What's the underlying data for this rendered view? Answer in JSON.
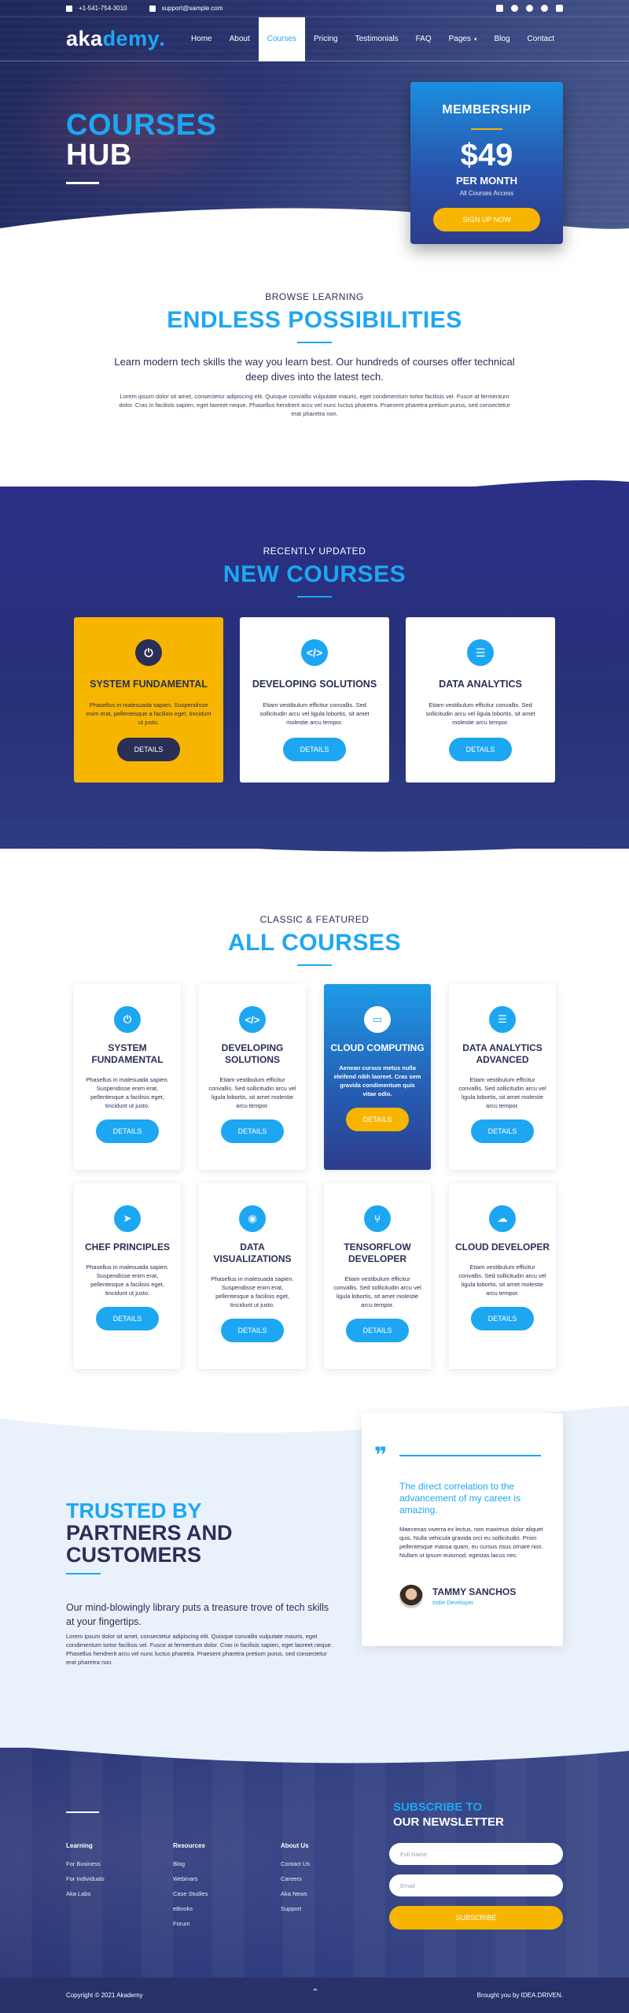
{
  "topbar": {
    "phone": "+1-541-754-3010",
    "email": "support@sample.com",
    "social": [
      "linkedin-icon",
      "facebook-icon",
      "twitter-icon",
      "skype-icon",
      "youtube-icon"
    ]
  },
  "nav": {
    "logo_main": "aka",
    "logo_accent": "demy",
    "items": [
      {
        "label": "Home"
      },
      {
        "label": "About"
      },
      {
        "label": "Courses",
        "active": true
      },
      {
        "label": "Pricing"
      },
      {
        "label": "Testimonials"
      },
      {
        "label": "FAQ"
      },
      {
        "label": "Pages",
        "caret": "▾"
      },
      {
        "label": "Blog"
      },
      {
        "label": "Contact"
      }
    ]
  },
  "hero": {
    "title_line1": "COURSES",
    "title_line2": "HUB",
    "membership": {
      "title": "MEMBERSHIP",
      "price": "$49",
      "period": "PER MONTH",
      "sub": "All Courses Access",
      "button": "SIGN UP NOW"
    }
  },
  "browse": {
    "eyebrow": "BROWSE LEARNING",
    "title": "ENDLESS POSSIBILITIES",
    "lead": "Learn modern tech skills the way you learn best. Our hundreds of courses offer technical deep dives into the latest tech.",
    "text": "Lorem ipsum dolor sit amet, consectetur adipiscing elit. Quisque convallis vulputate mauris, eget condimentum tortor facilisis vel. Fusce at fermentum dolor. Cras in facilisis sapien, eget laoreet neque. Phasellus hendrerit arcu vel nunc luctus pharetra. Praesent pharetra pretium purus, sed consectetur erat pharetra non."
  },
  "new_courses": {
    "eyebrow": "RECENTLY UPDATED",
    "title": "NEW COURSES",
    "cards": [
      {
        "title": "SYSTEM FUNDAMENTAL",
        "icon": "power-icon",
        "glyph": "⏻",
        "text": "Phasellus in malesuada sapien. Suspendisse enim erat, pellentesque a facilisis eget, tincidunt ut justo.",
        "button": "DETAILS"
      },
      {
        "title": "DEVELOPING SOLUTIONS",
        "icon": "code-icon",
        "glyph": "</>",
        "text": "Etiam vestibulum efficitur convallis. Sed sollicitudin arcu vel ligula lobortis, sit amet molestie arcu tempor.",
        "button": "DETAILS"
      },
      {
        "title": "DATA ANALYTICS",
        "icon": "database-icon",
        "glyph": "☰",
        "text": "Etiam vestibulum efficitur convallis. Sed sollicitudin arcu vel ligula lobortis, sit amet molestie arcu tempor.",
        "button": "DETAILS"
      }
    ]
  },
  "all_courses": {
    "eyebrow": "CLASSIC & FEATURED",
    "title": "ALL COURSES",
    "cards": [
      {
        "title": "SYSTEM FUNDAMENTAL",
        "icon": "power-icon",
        "glyph": "⏻",
        "text": "Phasellus in malesuada sapien. Suspendisse enim erat, pellentesque a facilisis eget, tincidunt ut justo.",
        "button": "DETAILS"
      },
      {
        "title": "DEVELOPING SOLUTIONS",
        "icon": "code-icon",
        "glyph": "</>",
        "text": "Etiam vestibulum efficitur convallis. Sed sollicitudin arcu vel ligula lobortis, sit amet molestie arcu tempor.",
        "button": "DETAILS"
      },
      {
        "title": "CLOUD COMPUTING",
        "icon": "monitor-icon",
        "glyph": "▭",
        "text": "Aenean cursus metus nulla eleifend nibh laoreet. Cras sem gravida condimentum quis vitae odio.",
        "button": "DETAILS",
        "highlight": true
      },
      {
        "title": "DATA ANALYTICS ADVANCED",
        "icon": "database-icon",
        "glyph": "☰",
        "text": "Etiam vestibulum efficitur convallis. Sed sollicitudin arcu vel ligula lobortis, sit amet molestie arcu tempor.",
        "button": "DETAILS"
      },
      {
        "title": "CHEF PRINCIPLES",
        "icon": "cursor-icon",
        "glyph": "➤",
        "text": "Phasellus in malesuada sapien. Suspendisse enim erat, pellentesque a facilisis eget, tincidunt ut justo.",
        "button": "DETAILS"
      },
      {
        "title": "DATA VISUALIZATIONS",
        "icon": "eye-icon",
        "glyph": "◉",
        "text": "Phasellus in malesuada sapien. Suspendisse enim erat, pellentesque a facilisis eget, tincidunt ut justo.",
        "button": "DETAILS"
      },
      {
        "title": "TENSORFLOW DEVELOPER",
        "icon": "branch-icon",
        "glyph": "⑂",
        "text": "Etiam vestibulum efficitur convallis. Sed sollicitudin arcu vel ligula lobortis, sit amet molestie arcu tempor.",
        "button": "DETAILS"
      },
      {
        "title": "CLOUD DEVELOPER",
        "icon": "cloud-icon",
        "glyph": "☁",
        "text": "Etiam vestibulum efficitur convallis. Sed sollicitudin arcu vel ligula lobortis, sit amet molestie arcu tempor.",
        "button": "DETAILS"
      }
    ]
  },
  "testimonial": {
    "title_line1": "TRUSTED BY",
    "title_line2": "PARTNERS AND",
    "title_line3": "CUSTOMERS",
    "lead": "Our mind-blowingly library puts a treasure trove of tech skills at your fingertips.",
    "text": "Lorem ipsum dolor sit amet, consectetur adipiscing elit. Quisque convallis vulputate mauris, eget condimentum tortor facilisis vel. Fusce at fermentum dolor. Cras in facilisis sapien, eget laoreet neque. Phasellus hendrerit arcu vel nunc luctus pharetra. Praesent pharetra pretium purus, sed consectetur erat pharetra non.",
    "quote": {
      "mark": "❞",
      "headline": "The direct correlation to the advancement of my career is amazing.",
      "body": "Maecenas viverra ex lectus, non maximus dolor aliquet quis. Nulla vehicula gravida orci eu sollicitudin. Proin pellentesque massa quam, eu cursus risus ornare non. Nullam ut ipsum euismod, egestas lacus nec.",
      "name": "TAMMY SANCHOS",
      "role": "Indie Developer"
    }
  },
  "footer": {
    "columns": [
      {
        "heading": "Learning",
        "links": [
          "For Business",
          "For Individuals",
          "Aka Labs"
        ]
      },
      {
        "heading": "Resources",
        "links": [
          "Blog",
          "Webinars",
          "Case Studies",
          "eBooks",
          "Forum"
        ]
      },
      {
        "heading": "About Us",
        "links": [
          "Contact Us",
          "Careers",
          "Aka News",
          "Support"
        ]
      }
    ],
    "newsletter": {
      "title_line1": "SUBSCRIBE TO",
      "title_line2": "OUR NEWSLETTER",
      "name_placeholder": "Full Name",
      "email_placeholder": "Email",
      "button": "SUBSCRIBE"
    },
    "copyright": "Copyright © 2021 Akademy",
    "up_arrow": "⌃",
    "credit": "Brought you by IDEA.DRIVEN."
  },
  "colors": {
    "accent": "#1da7f2",
    "navy": "#2a2f55",
    "band": "#2b2f86",
    "yellow": "#f7b500"
  }
}
